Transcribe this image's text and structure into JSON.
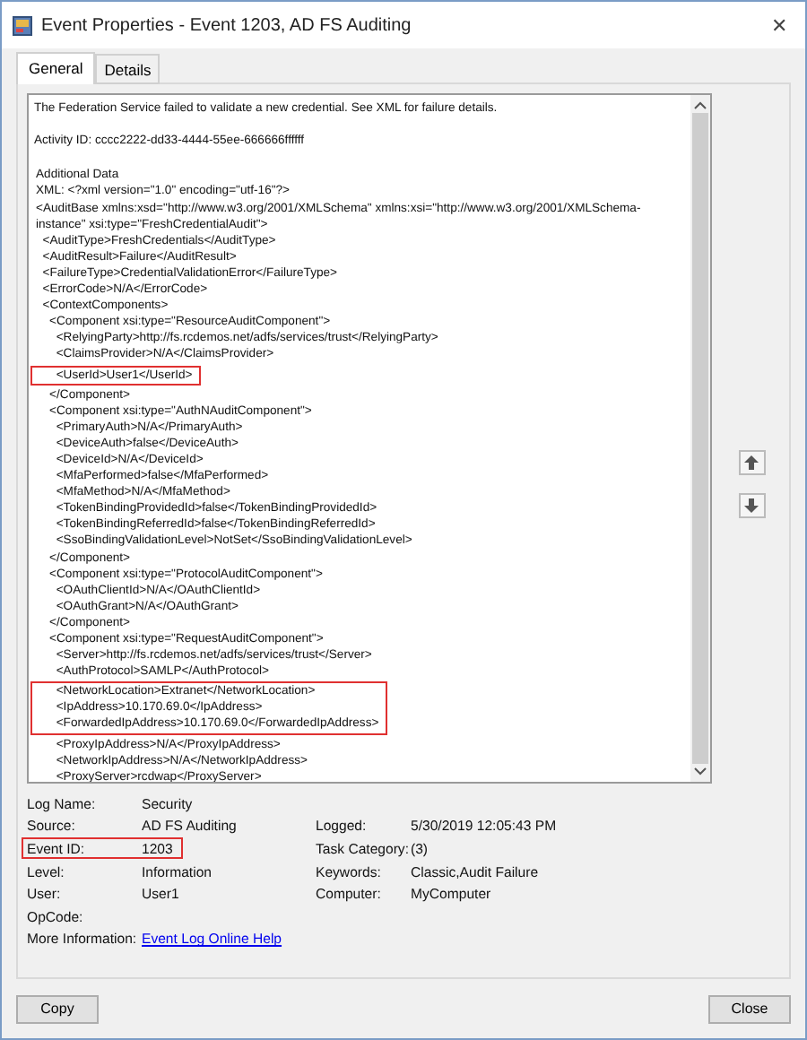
{
  "window": {
    "title": "Event Properties - Event 1203, AD FS Auditing",
    "close": "✕"
  },
  "tabs": [
    {
      "label": "General",
      "selected": true
    },
    {
      "label": "Details",
      "selected": false
    }
  ],
  "message": {
    "summary": "The Federation Service failed to validate a new credential. See XML for failure details.",
    "activity": "Activity ID: cccc2222-dd33-4444-55ee-666666ffffff",
    "blocks": [
      {
        "highlighted": false,
        "lines": [
          "Additional Data",
          "XML: <?xml version=\"1.0\" encoding=\"utf-16\"?>",
          "<AuditBase xmlns:xsd=\"http://www.w3.org/2001/XMLSchema\" xmlns:xsi=\"http://www.w3.org/2001/XMLSchema-",
          "instance\" xsi:type=\"FreshCredentialAudit\">",
          "  <AuditType>FreshCredentials</AuditType>",
          "  <AuditResult>Failure</AuditResult>",
          "  <FailureType>CredentialValidationError</FailureType>",
          "  <ErrorCode>N/A</ErrorCode>",
          "  <ContextComponents>",
          "    <Component xsi:type=\"ResourceAuditComponent\">",
          "      <RelyingParty>http://fs.rcdemos.net/adfs/services/trust</RelyingParty>",
          "      <ClaimsProvider>N/A</ClaimsProvider>"
        ]
      },
      {
        "highlighted": true,
        "lines": [
          "      <UserId>User1</UserId>"
        ]
      },
      {
        "highlighted": false,
        "lines": [
          "    </Component>",
          "    <Component xsi:type=\"AuthNAuditComponent\">",
          "      <PrimaryAuth>N/A</PrimaryAuth>",
          "      <DeviceAuth>false</DeviceAuth>",
          "      <DeviceId>N/A</DeviceId>",
          "      <MfaPerformed>false</MfaPerformed>",
          "      <MfaMethod>N/A</MfaMethod>",
          "      <TokenBindingProvidedId>false</TokenBindingProvidedId>",
          "      <TokenBindingReferredId>false</TokenBindingReferredId>",
          "      <SsoBindingValidationLevel>NotSet</SsoBindingValidationLevel>",
          "    </Component>",
          "    <Component xsi:type=\"ProtocolAuditComponent\">",
          "      <OAuthClientId>N/A</OAuthClientId>",
          "      <OAuthGrant>N/A</OAuthGrant>",
          "    </Component>",
          "    <Component xsi:type=\"RequestAuditComponent\">",
          "      <Server>http://fs.rcdemos.net/adfs/services/trust</Server>",
          "      <AuthProtocol>SAMLP</AuthProtocol>"
        ]
      },
      {
        "highlighted": true,
        "lines": [
          "      <NetworkLocation>Extranet</NetworkLocation>",
          "      <IpAddress>10.170.69.0</IpAddress>",
          "      <ForwardedIpAddress>10.170.69.0</ForwardedIpAddress>"
        ]
      },
      {
        "highlighted": false,
        "lines": [
          "      <ProxyIpAddress>N/A</ProxyIpAddress>",
          "      <NetworkIpAddress>N/A</NetworkIpAddress>",
          "      <ProxyServer>rcdwap</ProxyServer>"
        ]
      }
    ]
  },
  "fields": [
    {
      "label": "Log Name:",
      "value": "Security",
      "highlighted": false
    },
    {
      "label": "Source:",
      "value": "AD FS Auditing",
      "highlighted": false,
      "label2": "Logged:",
      "value2": "5/30/2019 12:05:43 PM"
    },
    {
      "label": "Event ID:",
      "value": "1203",
      "highlighted": true,
      "label2": "Task Category:",
      "value2": "(3)"
    },
    {
      "label": "Level:",
      "value": "Information",
      "highlighted": false,
      "label2": "Keywords:",
      "value2": "Classic,Audit Failure"
    },
    {
      "label": "User:",
      "value": "User1",
      "highlighted": false,
      "label2": "Computer:",
      "value2": "MyComputer"
    },
    {
      "label": "OpCode:",
      "highlighted": false
    },
    {
      "label": "More Information:",
      "link": "Event Log Online Help",
      "highlighted": false
    }
  ],
  "buttons": [
    {
      "label": "Copy"
    },
    {
      "label": "Close"
    }
  ]
}
